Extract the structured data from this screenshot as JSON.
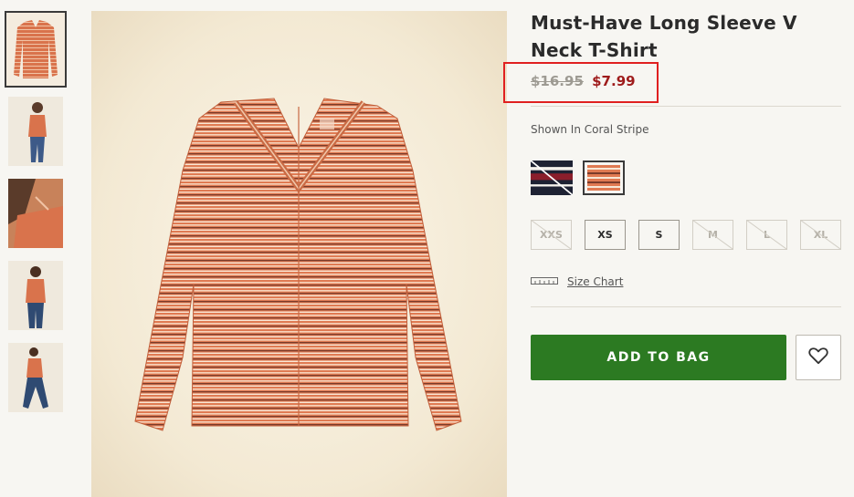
{
  "product": {
    "title": "Must-Have Long Sleeve V Neck T-Shirt",
    "price_original": "$16.95",
    "price_sale": "$7.99",
    "shown_in": "Shown In Coral Stripe"
  },
  "colors": {
    "accent_green": "#2c7a22",
    "sale_red": "#9e1b1b",
    "highlight_box": "#e02020",
    "coral": "#e07a52"
  },
  "swatches": [
    {
      "name": "navy-stripe",
      "selected": false
    },
    {
      "name": "coral-stripe",
      "selected": true
    }
  ],
  "sizes": [
    {
      "label": "XXS",
      "available": false
    },
    {
      "label": "XS",
      "available": true
    },
    {
      "label": "S",
      "available": true
    },
    {
      "label": "M",
      "available": false
    },
    {
      "label": "L",
      "available": false
    },
    {
      "label": "XL",
      "available": false
    }
  ],
  "size_chart": {
    "label": "Size Chart",
    "icon": "ruler-icon"
  },
  "actions": {
    "add_to_bag": "ADD TO BAG",
    "wishlist_icon": "heart-icon"
  },
  "thumbnails": [
    {
      "name": "flat-front",
      "selected": true
    },
    {
      "name": "model-front"
    },
    {
      "name": "model-detail"
    },
    {
      "name": "model-back"
    },
    {
      "name": "model-walking"
    }
  ]
}
